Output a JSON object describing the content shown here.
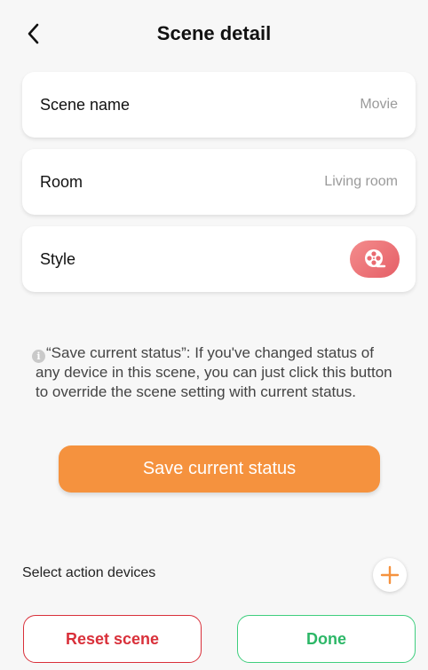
{
  "header": {
    "title": "Scene detail",
    "back_icon": "chevron-left-icon"
  },
  "scene_name": {
    "label": "Scene name",
    "value": "Movie"
  },
  "room": {
    "label": "Room",
    "value": "Living room"
  },
  "style": {
    "label": "Style",
    "icon": "film-reel-icon",
    "icon_color": "#e96a70"
  },
  "info": {
    "icon": "info-icon",
    "text": "“Save current status”: If you've changed status of any device in this scene, you can just click this button to override the scene setting with current status."
  },
  "save_button": {
    "label": "Save current status",
    "color": "#f5923e"
  },
  "action_devices": {
    "label": "Select action devices",
    "add_icon": "plus-icon",
    "accent": "#f5923e"
  },
  "footer": {
    "reset_label": "Reset scene",
    "reset_color": "#d9303a",
    "done_label": "Done",
    "done_color": "#2cb767"
  }
}
